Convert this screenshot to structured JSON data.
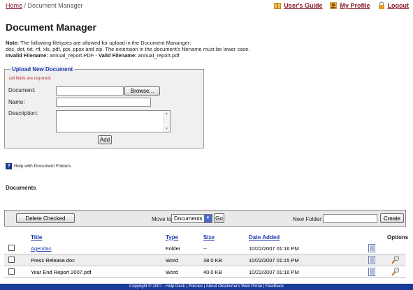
{
  "breadcrumb": {
    "home": "Home",
    "separator": "/",
    "current": "Document Manager"
  },
  "toplinks": {
    "guide": "User's Guide",
    "profile": "My Profile",
    "logout": "Logout"
  },
  "page": {
    "title": "Document Manager"
  },
  "note": {
    "label": "Note:",
    "line1": " The following filetypes are allowed for upload in the Document Mananger:",
    "line2": "doc, dot, txt, rtf, xls, pdf, ppt, ppsx and zip. The extension in the document's filename must be lower case.",
    "invalid_label": "Invalid Filename:",
    "invalid_value": " annual_report.PDF - ",
    "valid_label": "Valid Filename:",
    "valid_value": " annual_report.pdf"
  },
  "upload": {
    "legend": "Upload New Document",
    "required": "(all fields are required)",
    "document_label": "Document:",
    "browse": "Browse...",
    "name_label": "Name:",
    "description_label": "Description:",
    "add": "Add"
  },
  "help": {
    "text": "Help with Document Folders"
  },
  "documents": {
    "heading": "Documents"
  },
  "toolbar": {
    "delete_checked": "Delete Checked",
    "move_to_label": "Move to:",
    "move_to_selected": "Documents",
    "go": "Go",
    "new_folder_label": "New Folder:",
    "create": "Create"
  },
  "table": {
    "headers": {
      "title": "Title",
      "type": "Type",
      "size": "Size",
      "date_added": "Date Added",
      "options": "Options"
    },
    "rows": [
      {
        "title": "Agendas",
        "type": "Folder",
        "size": "--",
        "date": "10/22/2007 01:16 PM",
        "link": true
      },
      {
        "title": "Press Release.doc",
        "type": "Word",
        "size": "38.0 KB",
        "date": "10/22/2007 01:15 PM",
        "link": false
      },
      {
        "title": "Year End Report 2007.pdf",
        "type": "Word",
        "size": "40.0 KB",
        "date": "10/22/2007 01:16 PM",
        "link": false
      }
    ]
  },
  "footer": {
    "text": "Copyright © 2007 - Help Desk | Policies | About Oklahoma's Web Portal | Feedback"
  },
  "colors": {
    "link": "#1a3ab0",
    "topLink": "#8a1a2a",
    "footer": "#1a3a9a",
    "legend": "#1a3ab0"
  }
}
